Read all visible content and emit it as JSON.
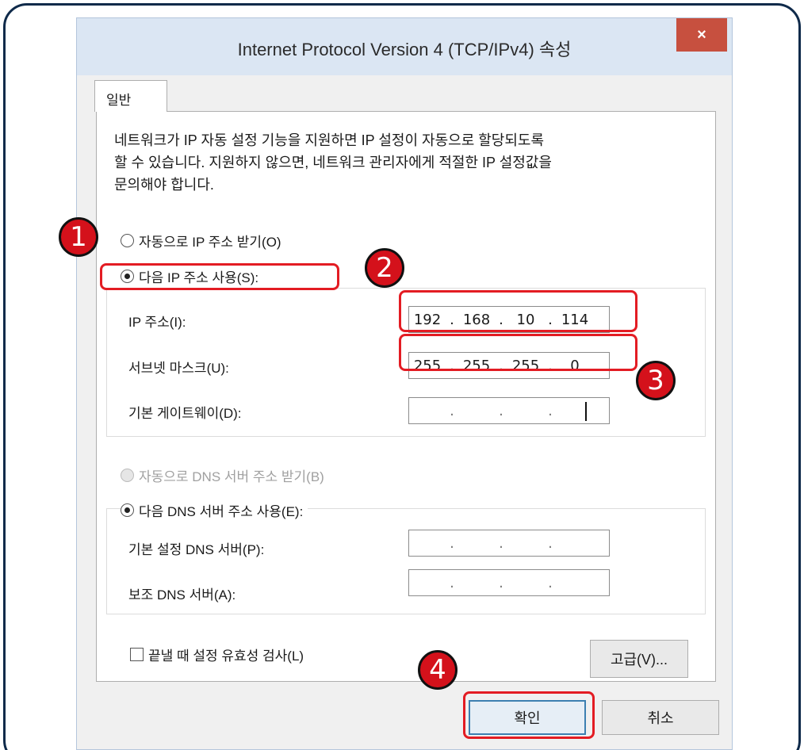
{
  "window": {
    "title": "Internet Protocol Version 4 (TCP/IPv4) 속성",
    "close_label": "×"
  },
  "tabs": [
    {
      "label": "일반"
    }
  ],
  "description": {
    "line1": "네트워크가 IP 자동 설정 기능을 지원하면 IP 설정이 자동으로 할당되도록",
    "line2": "할 수 있습니다. 지원하지 않으면, 네트워크 관리자에게 적절한 IP 설정값을",
    "line3": "문의해야 합니다."
  },
  "ip_mode": {
    "auto_label": "자동으로 IP 주소 받기(O)",
    "manual_label": "다음 IP 주소 사용(S):",
    "selected": "manual"
  },
  "ip_settings": {
    "ip_address_label": "IP 주소(I):",
    "ip_address": [
      "192",
      "168",
      "10",
      "114"
    ],
    "subnet_label": "서브넷 마스크(U):",
    "subnet": [
      "255",
      "255",
      "255",
      "0"
    ],
    "gateway_label": "기본 게이트웨이(D):",
    "gateway": [
      "",
      "",
      "",
      ""
    ]
  },
  "dns_mode": {
    "auto_label": "자동으로 DNS 서버 주소 받기(B)",
    "manual_label": "다음 DNS 서버 주소 사용(E):",
    "selected": "manual"
  },
  "dns_settings": {
    "preferred_label": "기본 설정 DNS 서버(P):",
    "preferred": [
      "",
      "",
      "",
      ""
    ],
    "alternate_label": "보조 DNS 서버(A):",
    "alternate": [
      "",
      "",
      "",
      ""
    ]
  },
  "validate_checkbox": {
    "label": "끝낼 때 설정 유효성 검사(L)",
    "checked": false
  },
  "buttons": {
    "advanced": "고급(V)...",
    "ok": "확인",
    "cancel": "취소"
  },
  "annotations": {
    "step1": "1",
    "step2": "2",
    "step3": "3",
    "step4": "4",
    "color": "#e31c23"
  }
}
